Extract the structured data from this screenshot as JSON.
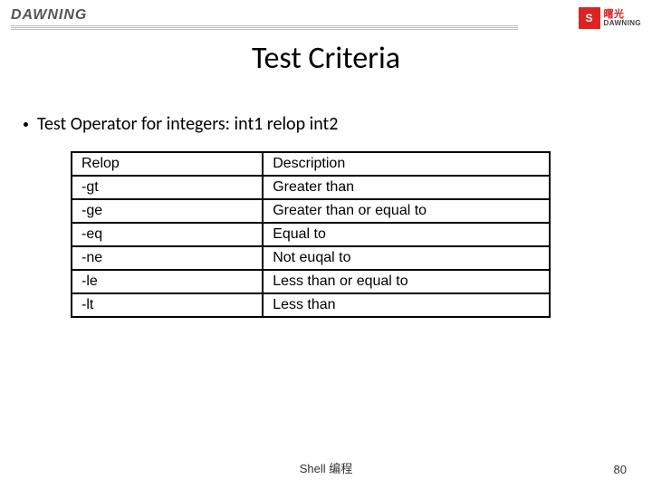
{
  "brand": {
    "left_text": "DAWNING",
    "right_main": "曙光",
    "right_small1": "DAWNING"
  },
  "title": "Test Criteria",
  "bullet": "Test Operator for integers:  int1 relop int2",
  "table": {
    "headers": [
      "Relop",
      "Description"
    ],
    "rows": [
      [
        "-gt",
        "Greater than"
      ],
      [
        "-ge",
        "Greater than or equal to"
      ],
      [
        "-eq",
        "Equal to"
      ],
      [
        "-ne",
        "Not euqal to"
      ],
      [
        "-le",
        "Less than or equal to"
      ],
      [
        "-lt",
        "Less than"
      ]
    ]
  },
  "footer": {
    "center": "Shell 编程",
    "page": "80"
  }
}
